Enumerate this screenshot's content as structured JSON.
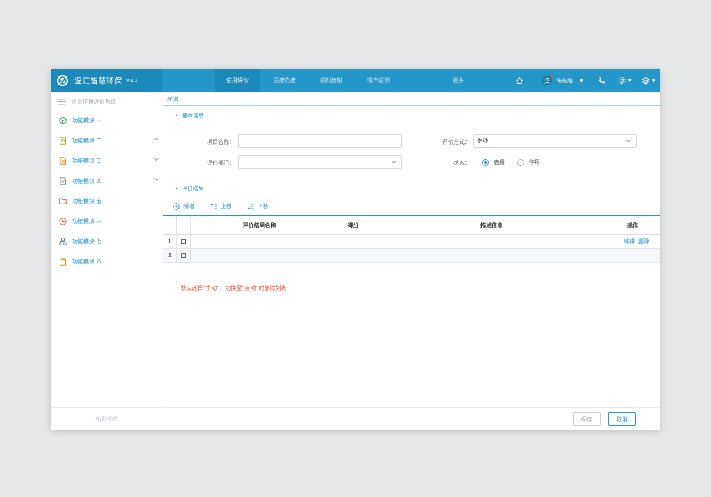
{
  "app": {
    "title": "温江智慧环保",
    "version": "V3.0"
  },
  "nav": {
    "tabs": [
      {
        "label": "信用评价",
        "active": true
      },
      {
        "label": "固废危废",
        "active": false
      },
      {
        "label": "辐射放射",
        "active": false
      },
      {
        "label": "噪声监测",
        "active": false
      },
      {
        "label": "更多",
        "active": false
      }
    ],
    "icons": [
      "home-icon",
      "user-icon",
      "phone-icon",
      "settings-icon",
      "layers-icon"
    ],
    "user_name": "张永和"
  },
  "sidebar": {
    "header": "企业信用评价系统",
    "items": [
      {
        "label": "功能模块 一",
        "icon": "cube-icon",
        "color": "#3fa35a",
        "expandable": false
      },
      {
        "label": "功能模块 二",
        "icon": "file-chart-icon",
        "color": "#c9a21a",
        "expandable": true
      },
      {
        "label": "功能模块 三",
        "icon": "document-icon",
        "color": "#e58a22",
        "expandable": true
      },
      {
        "label": "功能模块 四",
        "icon": "file-text-icon",
        "color": "#8a939b",
        "expandable": true
      },
      {
        "label": "功能模块 五",
        "icon": "folder-icon",
        "color": "#d9534f",
        "expandable": false
      },
      {
        "label": "功能模块 六",
        "icon": "clock-icon",
        "color": "#e8683a",
        "expandable": false
      },
      {
        "label": "功能模块 七",
        "icon": "org-chart-icon",
        "color": "#6c8a9f",
        "expandable": false
      },
      {
        "label": "功能模块 八",
        "icon": "clipboard-icon",
        "color": "#d99a1c",
        "expandable": false
      }
    ],
    "footer": "拓讯技术"
  },
  "page": {
    "tab_label": "新增",
    "basic_section": "基本信息",
    "fields": {
      "project_name_label": "项目名称：",
      "project_name_value": "",
      "method_label": "评价方式：",
      "method_value": "手动",
      "dept_label": "评价部门：",
      "dept_value": "",
      "status_label": "状态：",
      "status_on": "启用",
      "status_off": "停用",
      "status_selected": "启用"
    },
    "result_section": "评价结果",
    "toolbar": {
      "add": "新增",
      "up": "上移",
      "down": "下移"
    },
    "table": {
      "columns": [
        "评价结果名称",
        "得分",
        "描述信息",
        "操作"
      ],
      "rows": [
        {
          "index": "1",
          "name": "",
          "score": "",
          "desc": "",
          "ops": [
            "编辑",
            "删除"
          ]
        },
        {
          "index": "2",
          "name": "",
          "score": "",
          "desc": "",
          "ops": []
        }
      ]
    },
    "hint": "默认选择“手动”，切换至“自动”时删除列表",
    "buttons": {
      "save": "保存",
      "cancel": "取消"
    }
  },
  "colors": {
    "accent": "#2496c8",
    "accent_dark": "#1c89bb",
    "hint": "#e74c3c"
  }
}
